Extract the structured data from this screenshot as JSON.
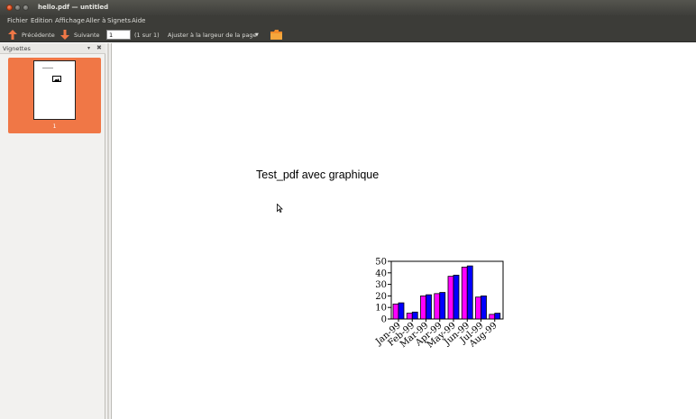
{
  "window": {
    "title": "hello.pdf — untitled"
  },
  "menu": {
    "items": [
      "Fichier",
      "Edition",
      "Affichage",
      "Aller à",
      "Signets",
      "Aide"
    ]
  },
  "toolbar": {
    "prev_label": "Précédente",
    "next_label": "Suivante",
    "page_value": "1",
    "page_count": "(1 sur 1)",
    "zoom_label": "Ajuster à la largeur de la page"
  },
  "sidebar": {
    "title": "Vignettes",
    "thumbnail_number": "1"
  },
  "document": {
    "heading": "Test_pdf avec graphique"
  },
  "colors": {
    "accent": "#f07746",
    "series_pink": "#ff00ff",
    "series_blue": "#0000ff"
  },
  "chart_data": {
    "type": "bar",
    "categories": [
      "Jan-99",
      "Feb-99",
      "Mar-99",
      "Apr-99",
      "May-99",
      "Jun-99",
      "Jul-99",
      "Aug-99"
    ],
    "series": [
      {
        "values": [
          13,
          5,
          20,
          22,
          37,
          45,
          19,
          4
        ]
      },
      {
        "values": [
          14,
          6,
          21,
          23,
          38,
          46,
          20,
          5
        ]
      }
    ],
    "ylim": [
      0,
      50
    ],
    "yticks": [
      "0",
      "10",
      "20",
      "30",
      "40",
      "50"
    ],
    "title": "",
    "xlabel": "",
    "ylabel": ""
  }
}
